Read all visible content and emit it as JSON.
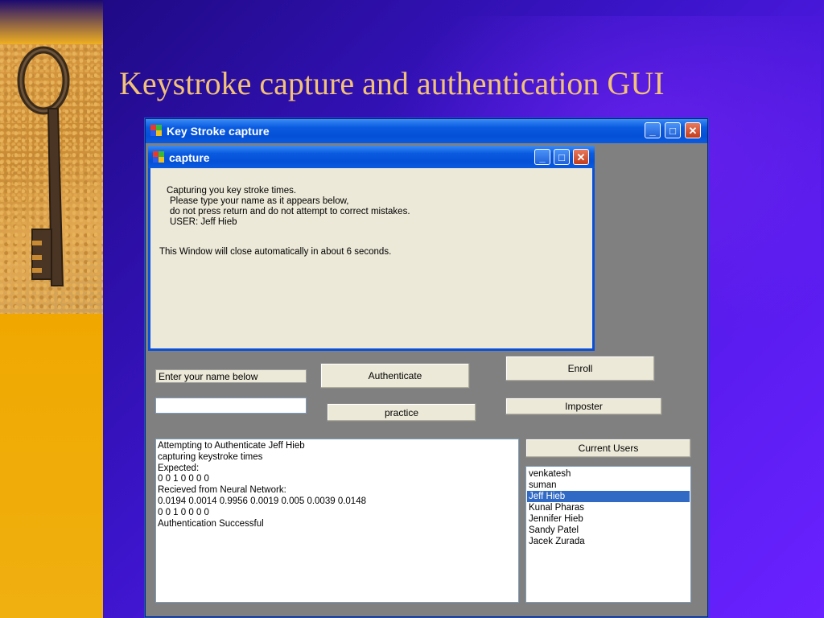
{
  "slide": {
    "title": "Keystroke capture and authentication GUI"
  },
  "main_window": {
    "title": "Key Stroke capture",
    "controls": {
      "minimize": "_",
      "maximize": "□",
      "close": "✕"
    }
  },
  "capture_window": {
    "title": "capture",
    "controls": {
      "minimize": "_",
      "maximize": "□",
      "close": "✕"
    },
    "lines": [
      "Capturing you key stroke times.",
      "Please type your name as it appears below,",
      "do not press return and do not attempt to correct mistakes.",
      "USER: Jeff Hieb"
    ],
    "close_notice": "This Window will close automatically in about 6 seconds."
  },
  "form": {
    "name_label": "Enter your name below",
    "name_value": "",
    "authenticate_button": "Authenticate",
    "practice_button": "practice",
    "enroll_button": "Enroll",
    "imposter_button": "Imposter",
    "current_users_button": "Current Users"
  },
  "output_lines": [
    "Attempting to Authenticate Jeff Hieb",
    "capturing keystroke times",
    "Expected:",
    "0 0 1 0 0 0 0",
    "Recieved from Neural Network:",
    "0.0194 0.0014 0.9956 0.0019 0.005 0.0039 0.0148",
    "0 0 1 0 0 0 0",
    "Authentication Successful"
  ],
  "users": {
    "items": [
      "venkatesh",
      "suman",
      "Jeff Hieb",
      "Kunal Pharas",
      "Jennifer Hieb",
      "Sandy Patel",
      "Jacek Zurada"
    ],
    "selected": "Jeff Hieb"
  },
  "colors": {
    "titlebar_blue": "#0a5ae0",
    "selection_blue": "#316ac5",
    "title_text": "#f2c27a"
  }
}
